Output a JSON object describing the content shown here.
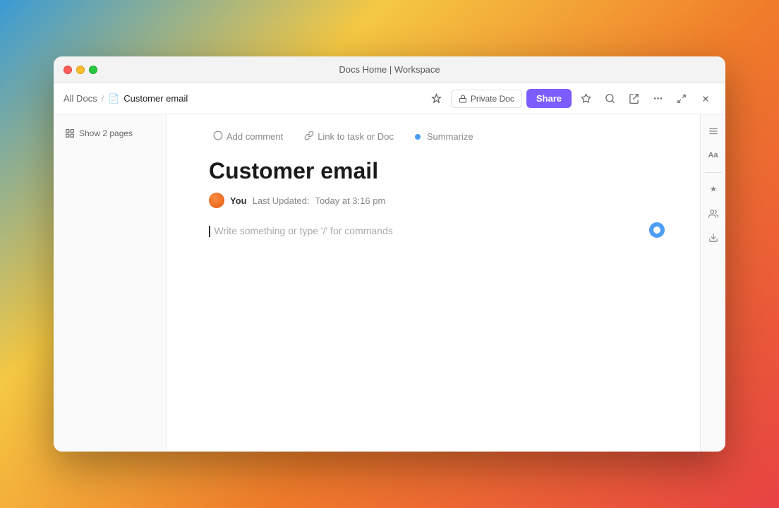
{
  "window": {
    "title": "Docs Home | Workspace"
  },
  "titlebar": {
    "close": "close",
    "minimize": "minimize",
    "maximize": "maximize"
  },
  "breadcrumb": {
    "all_docs": "All Docs",
    "separator": "/",
    "current_doc": "Customer email"
  },
  "nav": {
    "private_doc_label": "Private Doc",
    "share_label": "Share",
    "star_icon": "★",
    "search_icon": "⌕",
    "export_icon": "↗",
    "more_icon": "•••",
    "fullscreen_icon": "⤢",
    "close_icon": "✕",
    "lock_icon": "🔒"
  },
  "sidebar": {
    "show_pages_label": "Show 2 pages",
    "pages_icon": "⊞"
  },
  "toolbar": {
    "add_comment_label": "Add comment",
    "add_comment_icon": "○",
    "link_task_label": "Link to task or Doc",
    "link_task_icon": "↗",
    "summarize_label": "Summarize",
    "summarize_icon": "●"
  },
  "document": {
    "title": "Customer email",
    "author": "You",
    "last_updated_label": "Last Updated:",
    "last_updated_value": "Today at 3:16 pm",
    "placeholder": "Write something or type '/' for commands"
  },
  "right_sidebar": {
    "font_icon": "Aa",
    "star_icon": "✦",
    "person_icon": "☺",
    "download_icon": "↓",
    "menu_icon": "≡"
  },
  "colors": {
    "share_button": "#7c5cfc",
    "summarize_dot": "#4c9ef5",
    "editor_dot": "#4c9ef5"
  }
}
